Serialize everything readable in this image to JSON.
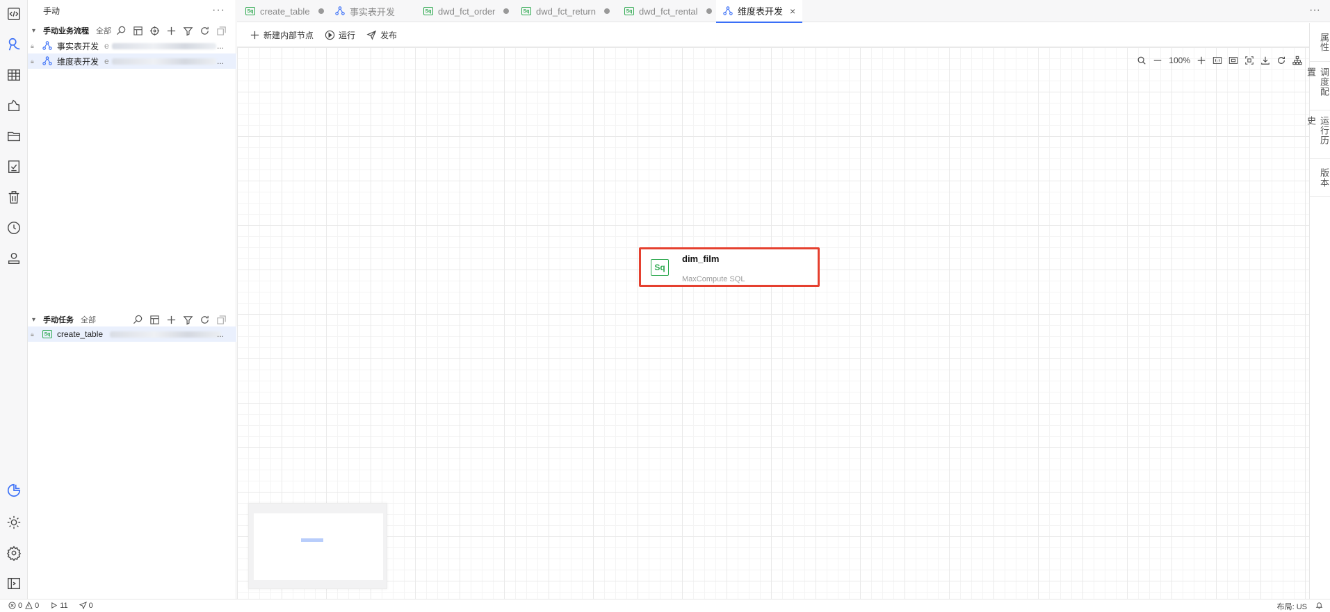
{
  "sidebar": {
    "title": "手动",
    "more_label": "···",
    "flow_group": {
      "title": "手动业务流程",
      "all_label": "全部"
    },
    "flow_items": [
      {
        "label": "事实表开发",
        "suffix": "e",
        "ellipsis": "..."
      },
      {
        "label": "维度表开发",
        "suffix": "e",
        "ellipsis": "..."
      }
    ],
    "task_group": {
      "title": "手动任务",
      "all_label": "全部"
    },
    "task_items": [
      {
        "icon_text": "Sq",
        "label": "create_table",
        "ellipsis": "..."
      }
    ]
  },
  "tabs": [
    {
      "icon": "sql-icon",
      "icon_text": "Sq",
      "label": "create_table",
      "dirty": true
    },
    {
      "icon": "workflow-icon",
      "label": "事实表开发",
      "dirty": false
    },
    {
      "icon": "sql-icon",
      "icon_text": "Sq",
      "label": "dwd_fct_order",
      "dirty": true
    },
    {
      "icon": "sql-icon",
      "icon_text": "Sq",
      "label": "dwd_fct_return",
      "dirty": true
    },
    {
      "icon": "sql-icon",
      "icon_text": "Sq",
      "label": "dwd_fct_rental",
      "dirty": true
    },
    {
      "icon": "workflow-icon",
      "label": "维度表开发",
      "active": true,
      "close": "×"
    }
  ],
  "tabs_more": "···",
  "toolbar": {
    "new_node_label": "新建内部节点",
    "run_label": "运行",
    "publish_label": "发布"
  },
  "canvas": {
    "zoom_level": "100%",
    "node": {
      "icon_text": "Sq",
      "title": "dim_film",
      "subtitle": "MaxCompute SQL"
    }
  },
  "right_panel": {
    "tabs": [
      "属性",
      "调度配置",
      "运行历史",
      "版本"
    ]
  },
  "status": {
    "errors": "0",
    "warnings": "0",
    "runs": "11",
    "publishes": "0",
    "layout": "布局: US"
  }
}
